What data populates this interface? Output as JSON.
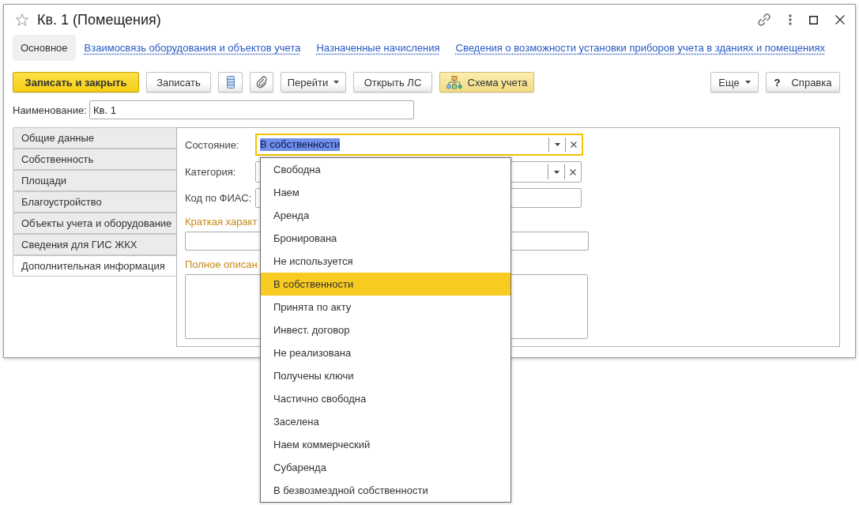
{
  "window": {
    "title": "Кв. 1 (Помещения)",
    "favorite": false
  },
  "nav_tabs": [
    {
      "label": "Основное",
      "selected": true
    },
    {
      "label": "Взаимосвязь оборудования и объектов учета",
      "selected": false
    },
    {
      "label": "Назначенные начисления",
      "selected": false
    },
    {
      "label": "Сведения о возможности установки приборов учета в зданиях и помещениях",
      "selected": false
    }
  ],
  "toolbar": {
    "save_and_close": "Записать и закрыть",
    "save": "Записать",
    "go_to": "Перейти",
    "open_account": "Открыть ЛС",
    "scheme": "Схема учета",
    "more": "Еще",
    "help_mark": "?",
    "help": "Справка"
  },
  "name_field": {
    "label": "Наименование:",
    "value": "Кв. 1"
  },
  "side_tabs": [
    {
      "label": "Общие данные",
      "selected": false
    },
    {
      "label": "Собственность",
      "selected": false
    },
    {
      "label": "Площади",
      "selected": false
    },
    {
      "label": "Благоустройство",
      "selected": false
    },
    {
      "label": "Объекты учета и оборудование",
      "selected": false
    },
    {
      "label": "Сведения для ГИС ЖКХ",
      "selected": false
    },
    {
      "label": "Дополнительная информация",
      "selected": true
    }
  ],
  "form": {
    "state": {
      "label": "Состояние:",
      "value": "В собственности",
      "focused": true,
      "value_selected": true
    },
    "category": {
      "label": "Категория:",
      "focused": false
    },
    "fias_code": {
      "label": "Код по ФИАС:"
    },
    "short_description": {
      "label": "Краткая характ"
    },
    "full_description": {
      "label": "Полное описан"
    }
  },
  "dropdown": {
    "options": [
      {
        "label": "Свободна",
        "selected": false
      },
      {
        "label": "Наем",
        "selected": false
      },
      {
        "label": "Аренда",
        "selected": false
      },
      {
        "label": "Бронирована",
        "selected": false
      },
      {
        "label": "Не используется",
        "selected": false
      },
      {
        "label": "В собственности",
        "selected": true
      },
      {
        "label": "Принята по акту",
        "selected": false
      },
      {
        "label": "Инвест. договор",
        "selected": false
      },
      {
        "label": "Не реализована",
        "selected": false
      },
      {
        "label": "Получены ключи",
        "selected": false
      },
      {
        "label": "Частично свободна",
        "selected": false
      },
      {
        "label": "Заселена",
        "selected": false
      },
      {
        "label": "Наем коммерческий",
        "selected": false
      },
      {
        "label": "Субаренда",
        "selected": false
      },
      {
        "label": "В безвозмездной собственности",
        "selected": false
      }
    ]
  }
}
